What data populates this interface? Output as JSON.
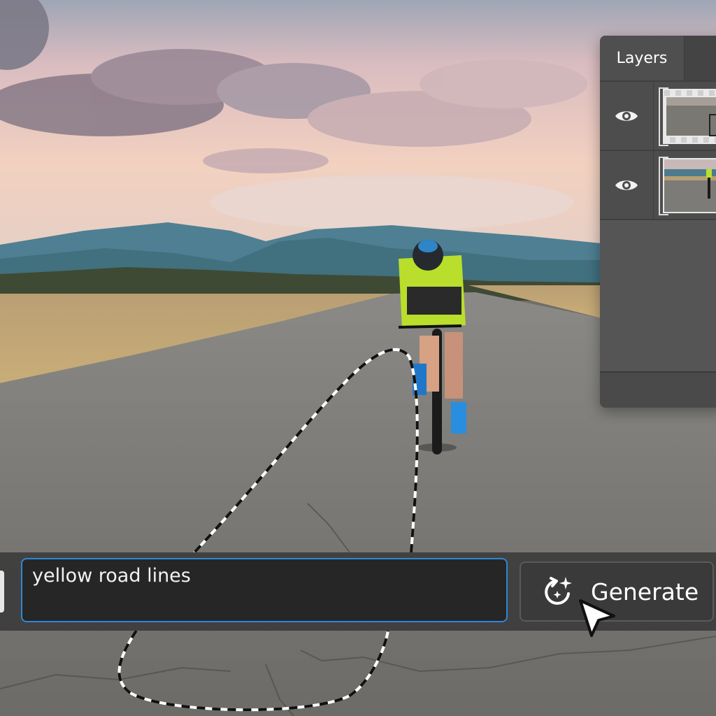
{
  "layers_panel": {
    "tab_label": "Layers",
    "layers": [
      {
        "visibility_icon": "eye-icon",
        "thumbnail": "generated-layer-thumbnail"
      },
      {
        "visibility_icon": "eye-icon",
        "thumbnail": "background-photo-thumbnail"
      }
    ]
  },
  "prompt": {
    "value": "yellow road lines",
    "generate_label": "Generate",
    "generate_icon": "generative-fill-icon"
  },
  "colors": {
    "input_focus_border": "#2f86d6",
    "panel_bg": "#535353",
    "bar_bg": "#3e3e3e"
  }
}
